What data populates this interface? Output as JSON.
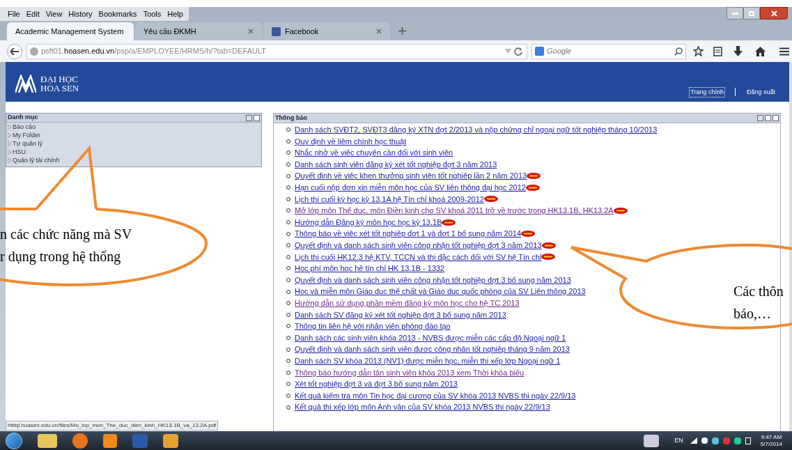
{
  "browser": {
    "menu": [
      "File",
      "Edit",
      "View",
      "History",
      "Bookmarks",
      "Tools",
      "Help"
    ],
    "tabs": [
      {
        "label": "Academic Management System",
        "selected": true,
        "has_icon": false
      },
      {
        "label": "Yêu cầu ĐKMH",
        "selected": false,
        "has_icon": false
      },
      {
        "label": "Facebook",
        "selected": false,
        "has_icon": true
      }
    ],
    "url": {
      "prefix": "psft01.",
      "host": "hoasen.edu.vn",
      "path": "/psp/a/EMPLOYEE/HRMS/h/?tab=DEFAULT"
    },
    "search_placeholder": "Google"
  },
  "header": {
    "logo_line1": "ĐẠI HỌC",
    "logo_line2": "HOA SEN",
    "links": [
      {
        "label": "Trang chính",
        "focused": true
      },
      {
        "label": "Đăng xuất",
        "focused": false
      }
    ]
  },
  "sidebar": {
    "title": "Danh mục",
    "items": [
      "Báo cáo",
      "My Folder",
      "Tự quản lý",
      "HSU",
      "Quản lý tài chính"
    ]
  },
  "notices": {
    "title": "Thông báo",
    "items": [
      {
        "text": "Danh sách SVĐT2, SVĐT3 đăng ký XTN đợt 2/2013 và nộp chứng chỉ ngoại ngữ tốt nghiệp tháng 10/2013",
        "visited": false,
        "new": false
      },
      {
        "text": "Quy định về liêm chính học thuật",
        "visited": false,
        "new": false
      },
      {
        "text": "Nhắc nhở về việc chuyên cần đối với sinh viên",
        "visited": false,
        "new": false
      },
      {
        "text": "Danh sách sinh viên đăng ký xét tốt nghiệp đợt 3 năm 2013",
        "visited": false,
        "new": false
      },
      {
        "text": "Quyết định về việc khen thưởng sinh viên tốt nghiệp lần 2 năm 2013",
        "visited": false,
        "new": true
      },
      {
        "text": "Hạn cuối nộp đơn xin miễn môn học của SV liên thông đại học 2012",
        "visited": false,
        "new": true
      },
      {
        "text": "Lịch thi cuối kỳ học kỳ 13.1A hệ Tín chỉ khoá 2009-2012",
        "visited": false,
        "new": true
      },
      {
        "text": "Mở lớp môn Thể dục, môn Điền kinh cho SV khoá 2011 trở về trước trong HK13.1B, HK13.2A",
        "visited": true,
        "new": true
      },
      {
        "text": "Hướng dẫn Đăng ký môn học học kỳ 13.1B",
        "visited": false,
        "new": true
      },
      {
        "text": "Thông báo về việc xét tốt nghiệp đợt 1 và đợt 1 bổ sung năm 2014",
        "visited": false,
        "new": true
      },
      {
        "text": "Quyết định và danh sách sinh viên công nhận tốt nghiệp đợt 3 năm 2013",
        "visited": false,
        "new": true
      },
      {
        "text": "Lịch thi cuối HK12.3 hệ KTV, TCCN và thi đặc cách đối với SV hệ Tín chỉ",
        "visited": false,
        "new": true
      },
      {
        "text": "Học phí môn học hệ tín chỉ HK 13.1B - 1332",
        "visited": false,
        "new": false
      },
      {
        "text": "Quyết định và danh sách sinh viên công nhận tốt nghiệp đợt 3 bổ sung năm 2013",
        "visited": false,
        "new": false
      },
      {
        "text": "Học và miễn môn Giáo dục thể chất và Giáo dục quốc phòng của SV Liên thông 2013",
        "visited": false,
        "new": false
      },
      {
        "text": "Hướng dẫn sử dụng phần mềm đăng ký môn học cho hệ TC 2013",
        "visited": true,
        "new": false
      },
      {
        "text": "Danh sách SV đăng ký xét tốt nghiệp đợt 3 bổ sung năm 2013",
        "visited": false,
        "new": false
      },
      {
        "text": "Thông tin liên hệ với nhân viên phòng đào tạo",
        "visited": false,
        "new": false
      },
      {
        "text": "Danh sách các sinh viên khóa 2013 - NVBS được miễn các cấp độ Ngoại ngữ 1",
        "visited": false,
        "new": false
      },
      {
        "text": "Quyết định và danh sách sinh viên được công nhận tốt nghiệp tháng 9 năm 2013",
        "visited": false,
        "new": false
      },
      {
        "text": "Danh sách SV khóa 2013 (NV1) được miễn học, miễn thi xếp lớp Ngoại ngữ 1",
        "visited": false,
        "new": false
      },
      {
        "text": "Thông báo hướng dẫn tân sinh viên khóa 2013 xem Thời khóa biểu",
        "visited": true,
        "new": false
      },
      {
        "text": "Xét tốt nghiệp đợt 3 và đợt 3 bổ sung năm 2013",
        "visited": false,
        "new": false
      },
      {
        "text": "Kết quả kiểm tra môn Tin học đại cương của SV khóa 2013 NVBS thi ngày 22/9/13",
        "visited": false,
        "new": false
      },
      {
        "text": "Kết quả thi xếp lớp môn Anh văn của SV khóa 2013 NVBS thi ngày 22/9/13",
        "visited": false,
        "new": false
      }
    ]
  },
  "status_url": "htttql.hoasen.edu.vn/files/Mo_lop_mon_The_duc_dien_kinh_HK13.1B_va_13.2A.pdf",
  "callouts": [
    {
      "lines": [
        "n các chức năng mà SV",
        "r dụng trong hệ thống"
      ]
    },
    {
      "lines": [
        "Các thôn",
        "báo,…"
      ]
    }
  ],
  "taskbar": {
    "lang": "EN",
    "time": "9:47 AM",
    "date": "5/7/2014"
  }
}
